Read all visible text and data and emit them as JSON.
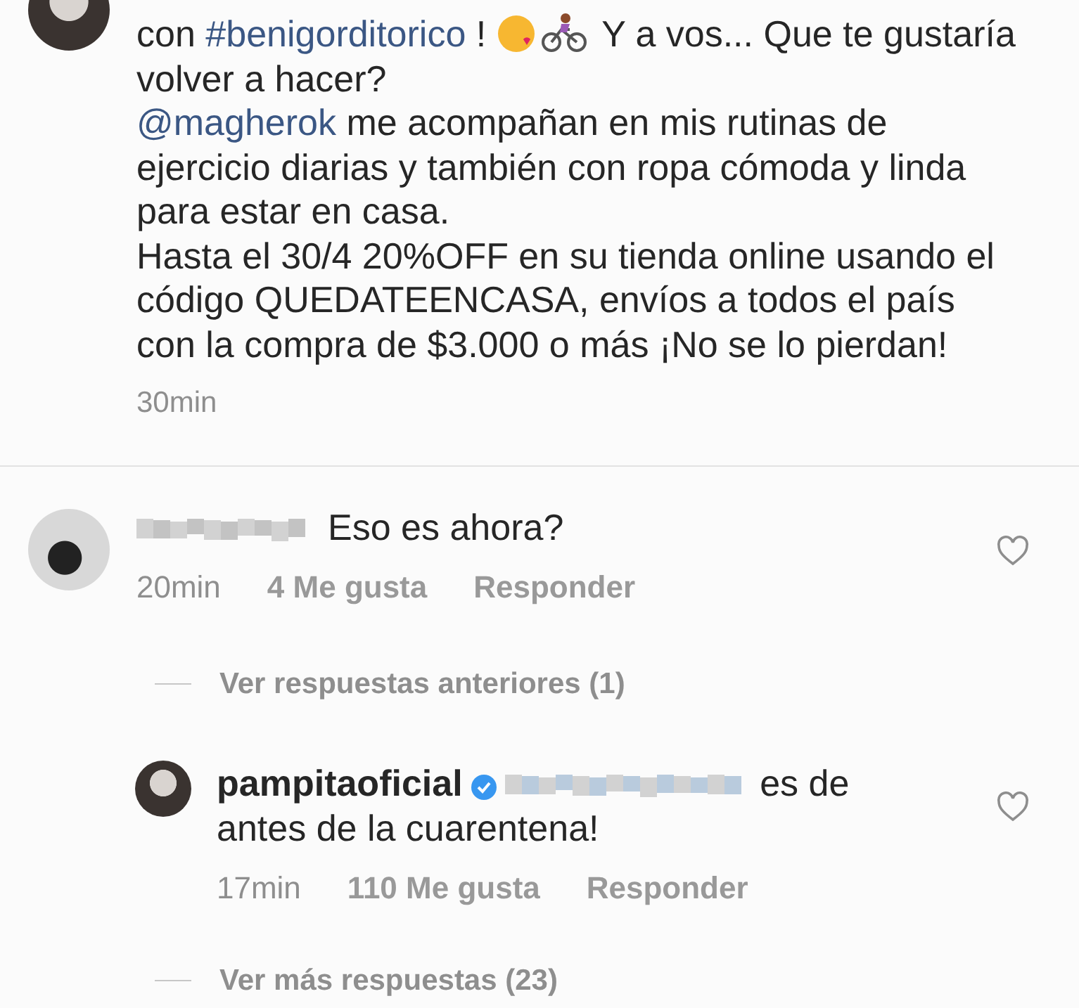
{
  "post": {
    "paragraphs": [
      {
        "parts": [
          {
            "kind": "text",
            "text": "con "
          },
          {
            "kind": "link",
            "text": "#benigorditorico"
          },
          {
            "kind": "text",
            "text": " ! "
          },
          {
            "kind": "emoji_kiss"
          },
          {
            "kind": "emoji_bike"
          },
          {
            "kind": "text",
            "text": " Y a vos... Que te gustaría volver a hacer?"
          }
        ]
      },
      {
        "parts": [
          {
            "kind": "link",
            "text": "@magherok"
          },
          {
            "kind": "text",
            "text": " me acompañan en mis rutinas de ejercicio diarias y también con ropa cómoda y linda para estar en casa."
          }
        ]
      },
      {
        "parts": [
          {
            "kind": "text",
            "text": "Hasta el 30/4 20%OFF en su tienda online usando el código QUEDATEENCASA, envíos a todos el país con la compra de $3.000 o más ¡No se lo pierdan!"
          }
        ]
      }
    ],
    "time": "30min"
  },
  "comment": {
    "username_blurred": true,
    "text": "Eso es ahora?",
    "time": "20min",
    "likes": "4 Me gusta",
    "reply": "Responder",
    "liked": false
  },
  "previous_replies": "Ver respuestas anteriores (1)",
  "reply": {
    "username": "pampitaoficial",
    "verified": true,
    "mention_blurred": true,
    "text": "es de antes de la cuarentena!",
    "time": "17min",
    "likes": "110 Me gusta",
    "reply": "Responder",
    "liked": false
  },
  "more_replies": "Ver más respuestas (23)"
}
